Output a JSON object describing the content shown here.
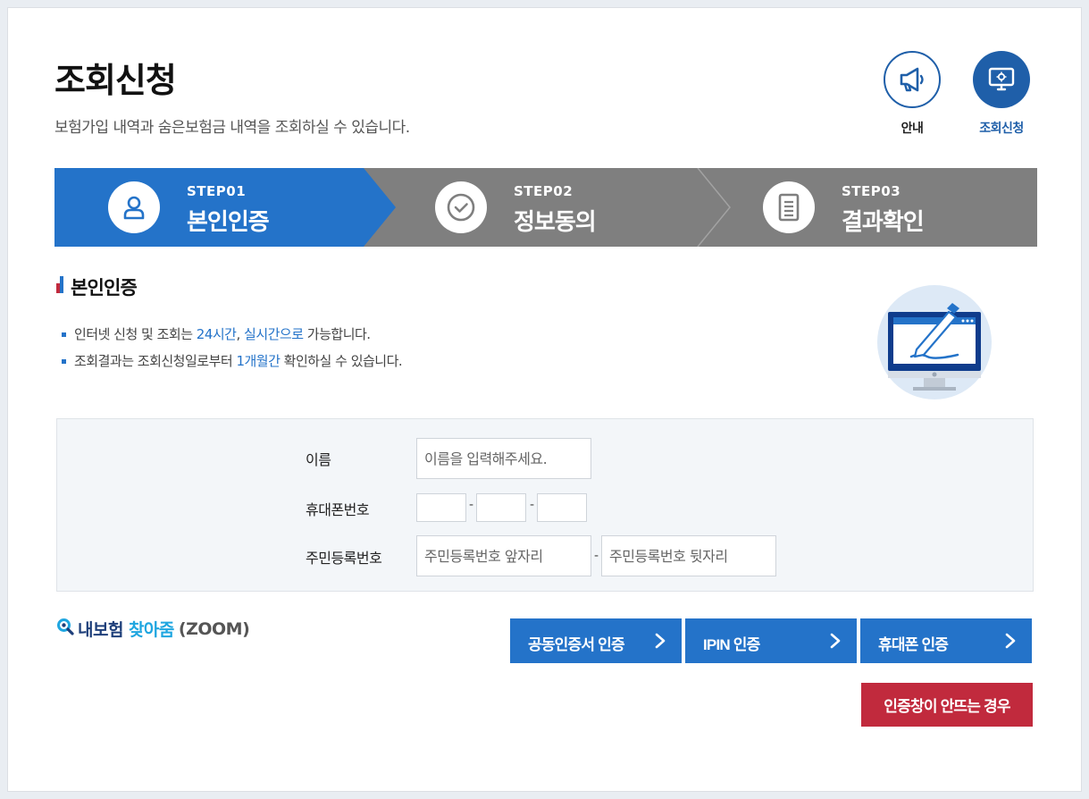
{
  "header": {
    "title": "조회신청",
    "description": "보험가입 내역과 숨은보험금 내역을 조회하실 수 있습니다."
  },
  "top_buttons": {
    "guide_label": "안내",
    "apply_label": "조회신청"
  },
  "steps": [
    {
      "num": "STEP01",
      "name": "본인인증",
      "active": true,
      "icon": "person-icon"
    },
    {
      "num": "STEP02",
      "name": "정보동의",
      "active": false,
      "icon": "check-circle-icon"
    },
    {
      "num": "STEP03",
      "name": "결과확인",
      "active": false,
      "icon": "document-icon"
    }
  ],
  "section": {
    "title": "본인인증",
    "notes": [
      {
        "pre": "인터넷 신청 및 조회는 ",
        "hl1": "24시간",
        "mid": ", ",
        "hl2": "실시간으로",
        "post": " 가능합니다."
      },
      {
        "pre": "조회결과는 조회신청일로부터 ",
        "hl1": "1개월간",
        "post": " 확인하실 수 있습니다."
      }
    ]
  },
  "form": {
    "name_label": "이름",
    "name_placeholder": "이름을 입력해주세요.",
    "phone_label": "휴대폰번호",
    "phone_separator": "-",
    "rrn_label": "주민등록번호",
    "rrn_front_placeholder": "주민등록번호 앞자리",
    "rrn_back_placeholder": "주민등록번호 뒷자리",
    "rrn_separator": "-"
  },
  "zoom_logo": {
    "part1": "내보험",
    "part2": "찾아줌",
    "part3": "(ZOOM)"
  },
  "auth_buttons": {
    "public_cert": "공동인증서 인증",
    "ipin": "IPIN 인증",
    "phone": "휴대폰 인증",
    "popup_fail": "인증창이 안뜨는 경우"
  },
  "colors": {
    "primary": "#2473c9",
    "inactive_step": "#7f7f7f",
    "danger": "#c12a3d",
    "dark_blue": "#1f5fa9"
  }
}
